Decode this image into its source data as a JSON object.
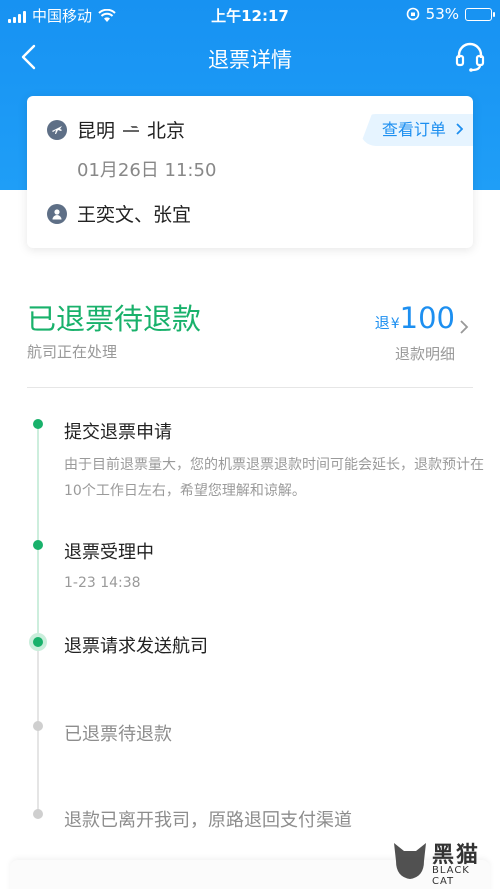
{
  "status_bar": {
    "carrier": "中国移动",
    "time": "上午12:17",
    "battery": "53%",
    "battery_level": 0.53
  },
  "nav": {
    "title": "退票详情",
    "back_icon": "back-chevron-icon",
    "support_icon": "headset-icon"
  },
  "flight": {
    "origin": "昆明",
    "destination": "北京",
    "datetime": "01月26日 11:50",
    "passengers": "王奕文、张宜",
    "view_order": "查看订单"
  },
  "refund": {
    "status": "已退票待退款",
    "substatus": "航司正在处理",
    "amount_prefix": "退",
    "currency": "¥",
    "amount": "100",
    "detail_label": "退款明细"
  },
  "timeline": [
    {
      "title": "提交退票申请",
      "desc": "由于目前退票量大，您的机票退票退款时间可能会延长，退款预计在10个工作日左右，希望您理解和谅解。",
      "state": "done"
    },
    {
      "title": "退票受理中",
      "desc": "1-23 14:38",
      "state": "done"
    },
    {
      "title": "退票请求发送航司",
      "desc": "",
      "state": "current"
    },
    {
      "title": "已退票待退款",
      "desc": "",
      "state": "pending"
    },
    {
      "title": "退款已离开我司，原路退回支付渠道",
      "desc": "",
      "state": "pending"
    }
  ],
  "watermark": {
    "name": "黑猫",
    "sub": "BLACK CAT"
  },
  "colors": {
    "header_blue": "#1792f2",
    "accent_blue": "#1d8ff0",
    "success_green": "#19b16b",
    "pending_gray": "#cfcfcf"
  }
}
